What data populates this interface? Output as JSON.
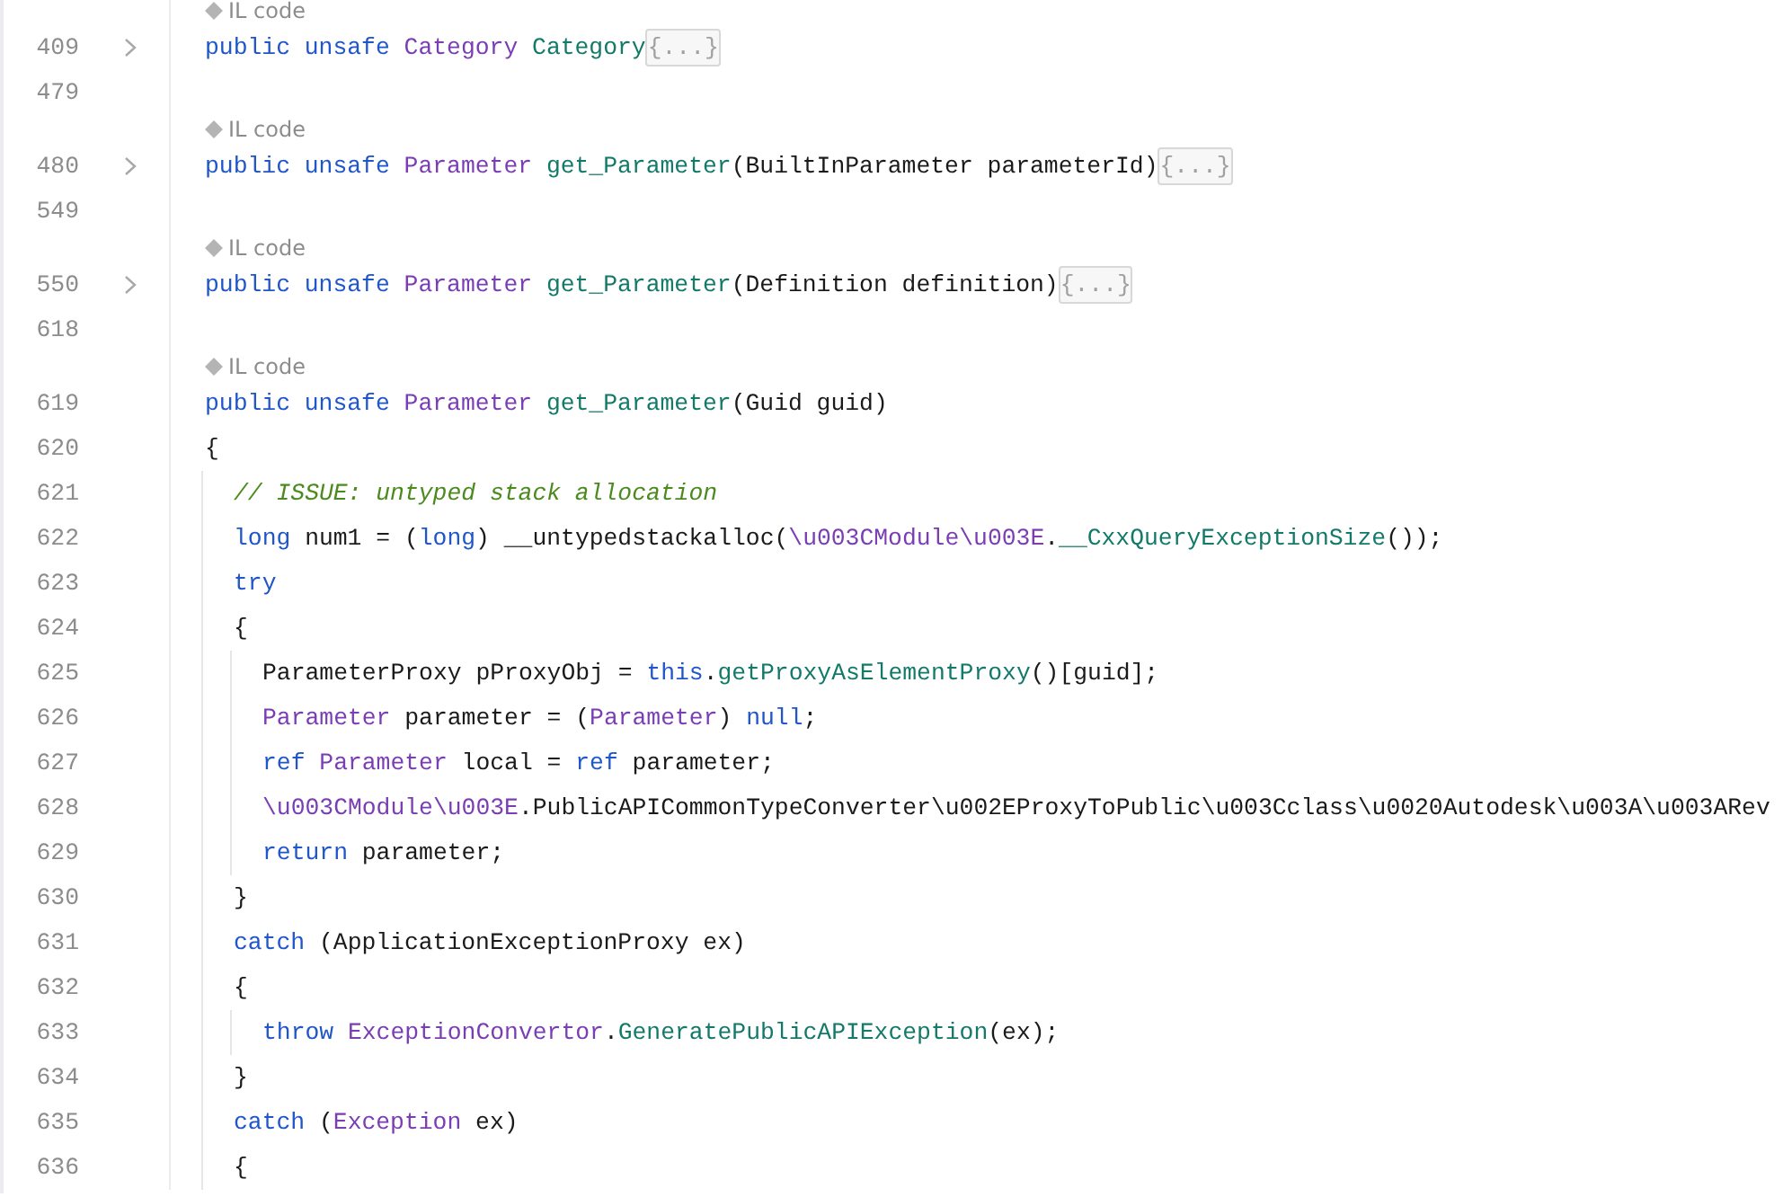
{
  "editor": {
    "lines": [
      {
        "number": "409",
        "hint": "IL code",
        "folded": true,
        "tokens": [
          {
            "kind": "keyword",
            "text": "public unsafe "
          },
          {
            "kind": "type",
            "text": "Category "
          },
          {
            "kind": "method",
            "text": "Category"
          }
        ],
        "placeholder": "{...}"
      },
      {
        "number": "479"
      },
      {
        "number": "480",
        "hint": "IL code",
        "folded": true,
        "tokens": [
          {
            "kind": "keyword",
            "text": "public unsafe "
          },
          {
            "kind": "type",
            "text": "Parameter "
          },
          {
            "kind": "method",
            "text": "get_Parameter"
          },
          {
            "kind": "plain",
            "text": "(BuiltInParameter parameterId)"
          }
        ],
        "placeholder": "{...}"
      },
      {
        "number": "549"
      },
      {
        "number": "550",
        "hint": "IL code",
        "folded": true,
        "tokens": [
          {
            "kind": "keyword",
            "text": "public unsafe "
          },
          {
            "kind": "type",
            "text": "Parameter "
          },
          {
            "kind": "method",
            "text": "get_Parameter"
          },
          {
            "kind": "plain",
            "text": "(Definition definition)"
          }
        ],
        "placeholder": "{...}"
      },
      {
        "number": "618"
      },
      {
        "number": "619",
        "hint": "IL code",
        "folded": false,
        "tokens": [
          {
            "kind": "keyword",
            "text": "public unsafe "
          },
          {
            "kind": "type",
            "text": "Parameter "
          },
          {
            "kind": "method",
            "text": "get_Parameter"
          },
          {
            "kind": "plain",
            "text": "(Guid guid)"
          }
        ]
      },
      {
        "number": "620",
        "tokens": [
          {
            "kind": "plain",
            "text": "{"
          }
        ],
        "children": [
          {
            "number": "621",
            "tokens": [
              {
                "kind": "comment",
                "text": "// ISSUE: untyped stack allocation"
              }
            ]
          },
          {
            "number": "622",
            "tokens": [
              {
                "kind": "keyword",
                "text": "long"
              },
              {
                "kind": "plain",
                "text": " num1 = ("
              },
              {
                "kind": "keyword",
                "text": "long"
              },
              {
                "kind": "plain",
                "text": ") __untypedstackalloc("
              },
              {
                "kind": "type",
                "text": "\\u003CModule\\u003E"
              },
              {
                "kind": "plain",
                "text": "."
              },
              {
                "kind": "method",
                "text": "__CxxQueryExceptionSize"
              },
              {
                "kind": "plain",
                "text": "());"
              }
            ]
          },
          {
            "number": "623",
            "tokens": [
              {
                "kind": "keyword",
                "text": "try"
              }
            ]
          },
          {
            "number": "624",
            "tokens": [
              {
                "kind": "plain",
                "text": "{"
              }
            ],
            "children": [
              {
                "number": "625",
                "tokens": [
                  {
                    "kind": "plain",
                    "text": "ParameterProxy pProxyObj = "
                  },
                  {
                    "kind": "keyword",
                    "text": "this"
                  },
                  {
                    "kind": "plain",
                    "text": "."
                  },
                  {
                    "kind": "method",
                    "text": "getProxyAsElementProxy"
                  },
                  {
                    "kind": "plain",
                    "text": "()[guid];"
                  }
                ]
              },
              {
                "number": "626",
                "tokens": [
                  {
                    "kind": "type",
                    "text": "Parameter"
                  },
                  {
                    "kind": "plain",
                    "text": " parameter = ("
                  },
                  {
                    "kind": "type",
                    "text": "Parameter"
                  },
                  {
                    "kind": "plain",
                    "text": ") "
                  },
                  {
                    "kind": "keyword",
                    "text": "null"
                  },
                  {
                    "kind": "plain",
                    "text": ";"
                  }
                ]
              },
              {
                "number": "627",
                "tokens": [
                  {
                    "kind": "keyword",
                    "text": "ref "
                  },
                  {
                    "kind": "type",
                    "text": "Parameter"
                  },
                  {
                    "kind": "plain",
                    "text": " local = "
                  },
                  {
                    "kind": "keyword",
                    "text": "ref"
                  },
                  {
                    "kind": "plain",
                    "text": " parameter;"
                  }
                ]
              },
              {
                "number": "628",
                "tokens": [
                  {
                    "kind": "type",
                    "text": "\\u003CModule\\u003E"
                  },
                  {
                    "kind": "plain",
                    "text": ".PublicAPICommonTypeConverter\\u002EProxyToPublic\\u003Cclass\\u0020Autodesk\\u003A\\u003ARev"
                  }
                ]
              },
              {
                "number": "629",
                "tokens": [
                  {
                    "kind": "keyword",
                    "text": "return"
                  },
                  {
                    "kind": "plain",
                    "text": " parameter;"
                  }
                ]
              }
            ]
          },
          {
            "number": "630",
            "tokens": [
              {
                "kind": "plain",
                "text": "}"
              }
            ]
          },
          {
            "number": "631",
            "tokens": [
              {
                "kind": "keyword",
                "text": "catch"
              },
              {
                "kind": "plain",
                "text": " (ApplicationExceptionProxy ex)"
              }
            ]
          },
          {
            "number": "632",
            "tokens": [
              {
                "kind": "plain",
                "text": "{"
              }
            ],
            "children": [
              {
                "number": "633",
                "tokens": [
                  {
                    "kind": "keyword",
                    "text": "throw "
                  },
                  {
                    "kind": "type",
                    "text": "ExceptionConvertor"
                  },
                  {
                    "kind": "plain",
                    "text": "."
                  },
                  {
                    "kind": "method",
                    "text": "GeneratePublicAPIException"
                  },
                  {
                    "kind": "plain",
                    "text": "(ex);"
                  }
                ]
              }
            ]
          },
          {
            "number": "634",
            "tokens": [
              {
                "kind": "plain",
                "text": "}"
              }
            ]
          },
          {
            "number": "635",
            "tokens": [
              {
                "kind": "keyword",
                "text": "catch"
              },
              {
                "kind": "plain",
                "text": " ("
              },
              {
                "kind": "type",
                "text": "Exception"
              },
              {
                "kind": "plain",
                "text": " ex)"
              }
            ]
          },
          {
            "number": "636",
            "tokens": [
              {
                "kind": "plain",
                "text": "{"
              }
            ]
          }
        ]
      }
    ]
  }
}
